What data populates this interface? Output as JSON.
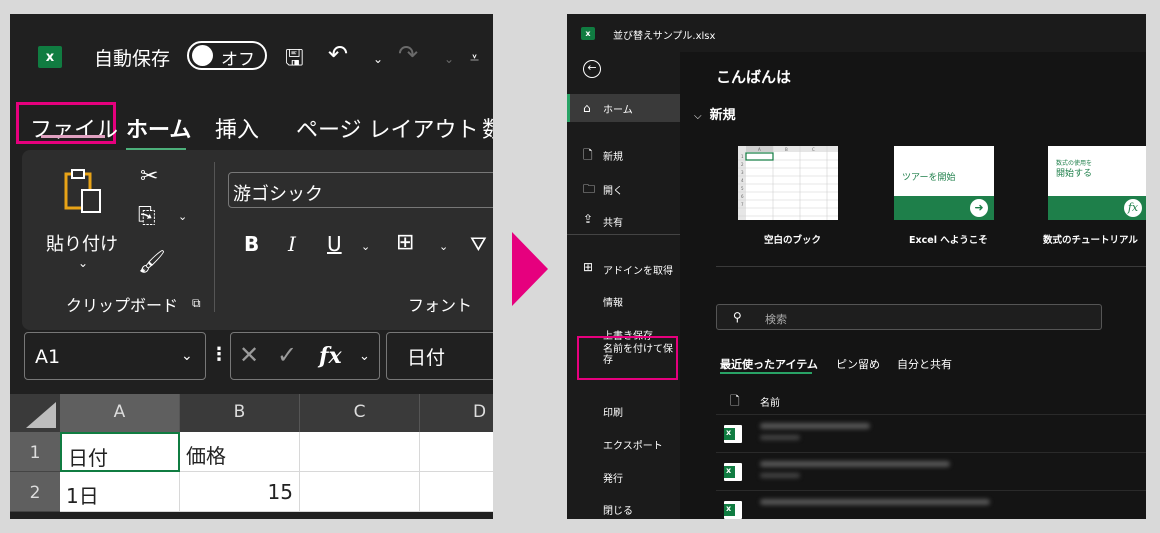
{
  "left": {
    "logo": "x",
    "autosave_label": "自動保存",
    "toggle_label": "オフ",
    "save_icon": "save-icon",
    "undo_icon": "undo-icon",
    "redo_icon": "redo-icon",
    "tabs": {
      "file": "ファイル",
      "home": "ホーム",
      "insert": "挿入",
      "page_layout": "ページ レイアウト",
      "more": "数"
    },
    "clipboard": {
      "paste_label": "貼り付け",
      "group_label": "クリップボード"
    },
    "font": {
      "font_name": "游ゴシック",
      "bold": "B",
      "italic": "I",
      "underline": "U",
      "group_label": "フォント"
    },
    "formula_bar": {
      "name_box": "A1",
      "fx": "fx",
      "content": "日付"
    },
    "grid": {
      "columns": [
        "A",
        "B",
        "C",
        "D"
      ],
      "rows": [
        {
          "num": "1",
          "a": "日付",
          "b": "価格"
        },
        {
          "num": "2",
          "a": "1日",
          "b": "15"
        }
      ]
    }
  },
  "right": {
    "logo": "x",
    "filename": "並び替えサンプル.xlsx",
    "nav": {
      "home": "ホーム",
      "new": "新規",
      "open": "開く",
      "share": "共有",
      "addins": "アドインを取得",
      "info": "情報",
      "save": "上書き保存",
      "save_as": "名前を付けて保存",
      "print": "印刷",
      "export": "エクスポート",
      "publish": "発行",
      "close": "閉じる"
    },
    "greeting": "こんばんは",
    "new_header": "新規",
    "templates": [
      {
        "label": "空白のブック"
      },
      {
        "label": "Excel へようこそ",
        "thumb_text": "ツアーを開始"
      },
      {
        "label": "数式のチュートリアル",
        "thumb_text_small": "数式の使用を",
        "thumb_text_big": "開始する"
      }
    ],
    "search_placeholder": "検索",
    "file_tabs": {
      "recent": "最近使ったアイテム",
      "pinned": "ピン留め",
      "shared": "自分と共有"
    },
    "name_column": "名前",
    "accent_color": "#107c41",
    "highlight_color": "#e6007e"
  }
}
